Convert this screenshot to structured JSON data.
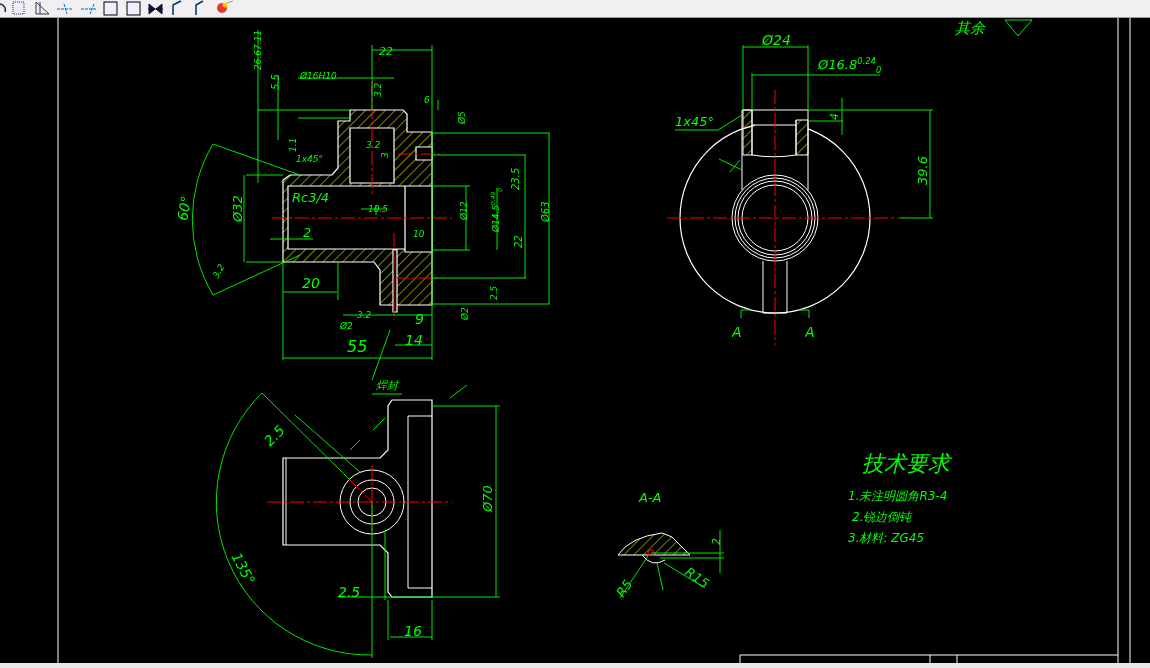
{
  "front_view": {
    "labels": [
      "22",
      "26.67.11",
      "5.5",
      "Ø16H10",
      "3.2",
      "6",
      "Ø5",
      "1.1",
      "1x45°",
      "3.2",
      "3",
      "Rc3/4",
      "10.5",
      "23.5",
      "Ø12",
      "Ø14.5$^{0.49}$$_{0}$",
      "Ø63",
      "60°",
      "Ø32",
      "2",
      "10",
      "22",
      "3.2",
      "20",
      "Ø2",
      "2.5",
      "Ø2",
      "3.2",
      "9",
      "14",
      "55",
      "焊封"
    ]
  },
  "side_view": {
    "labels": [
      "Ø24",
      "Ø16.8$^{0.24}$$_{0}$",
      "1x45°",
      "4",
      "39.6",
      "A",
      "A",
      "其余"
    ]
  },
  "bottom_view": {
    "labels": [
      "2.5",
      "135°",
      "2.5",
      "Ø70",
      "16"
    ]
  },
  "section_view": {
    "title": "A-A",
    "labels": [
      "2",
      "R5",
      "R15"
    ]
  },
  "technical_requirements": {
    "title": "技术要求",
    "items": [
      "1.未注明圆角R3-4",
      "2.锐边倒钝",
      "3.材料: ZG45"
    ]
  }
}
